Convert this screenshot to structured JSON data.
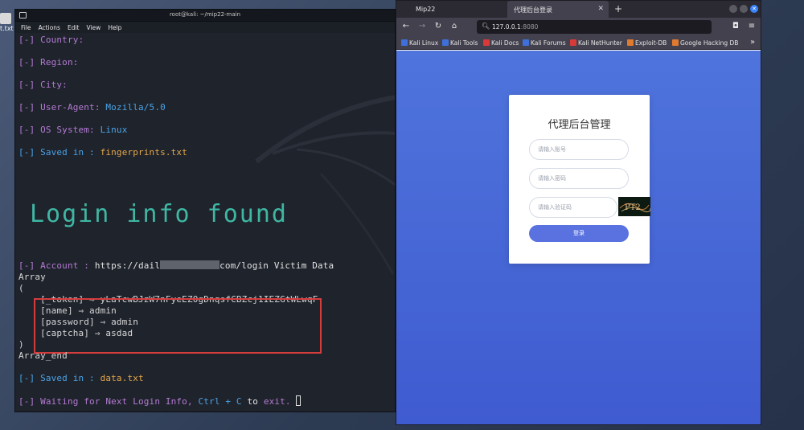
{
  "desktop": {
    "icon_label": "t.txt"
  },
  "terminal": {
    "title": "root@kali: ~/mip22-main",
    "menu": [
      "File",
      "Actions",
      "Edit",
      "View",
      "Help"
    ],
    "lines": {
      "country_label": "[-] Country:",
      "region_label": "[-] Region:",
      "city_label": "[-] City:",
      "ua_label": "[-] User-Agent:",
      "ua_value": "Mozilla/5.0",
      "os_label": "[-] OS System:",
      "os_value": "Linux",
      "saved_prefix": "[-] Saved in :",
      "saved_file": "fingerprints.txt",
      "ascii_text": "Login info found",
      "account_prefix": "[-] Account :",
      "account_url_start": "https://dail",
      "account_url_end": "com/login Victim Data",
      "array_open": "Array",
      "paren_open": "(",
      "token_line": "    [_token] ⇒ yLaTcwBJzW7nFyeEZ0gDnqsfCBZcj1IEZGtWLwqF",
      "name_line": "    [name] ⇒ admin",
      "password_line": "    [password] ⇒ admin",
      "captcha_line": "    [captcha] ⇒ asdad",
      "paren_close": ")",
      "array_end": "Array_end",
      "saved2_prefix": "[-] Saved in :",
      "saved2_file": "data.txt",
      "waiting_prefix": "[-] Waiting for Next Login Info,",
      "waiting_key": "Ctrl + C",
      "waiting_to": "to",
      "waiting_exit": "exit."
    }
  },
  "browser": {
    "tabs": [
      {
        "label": "Mip22"
      },
      {
        "label": "代理后台登录"
      }
    ],
    "new_tab": "+",
    "nav": {
      "back": "←",
      "forward": "→",
      "reload": "↻",
      "home": "⌂"
    },
    "url": {
      "host": "127.0.0.1",
      "port": ":8080"
    },
    "bookmarks": [
      {
        "label": "Kali Linux",
        "color": "#3f6fd8"
      },
      {
        "label": "Kali Tools",
        "color": "#3f6fd8"
      },
      {
        "label": "Kali Docs",
        "color": "#d83a3a"
      },
      {
        "label": "Kali Forums",
        "color": "#3f6fd8"
      },
      {
        "label": "Kali NetHunter",
        "color": "#d83a3a"
      },
      {
        "label": "Exploit-DB",
        "color": "#e07a2f"
      },
      {
        "label": "Google Hacking DB",
        "color": "#e07a2f"
      }
    ],
    "bookmarks_more": "»",
    "page": {
      "title": "代理后台管理",
      "username_placeholder": "请输入账号",
      "password_placeholder": "请输入密码",
      "captcha_placeholder": "请输入验证码",
      "submit_label": "登录",
      "captcha_text": "PT2"
    }
  },
  "colors": {
    "terminal_bg": "#1f232c",
    "prompt_purple": "#b47bd4",
    "value_blue": "#4aa3e6",
    "file_orange": "#e5a84b",
    "ascii_teal": "#3fb7a3",
    "highlight_red": "#d53c3c",
    "login_bg": "#4f74dc",
    "login_button": "#5a72df"
  }
}
